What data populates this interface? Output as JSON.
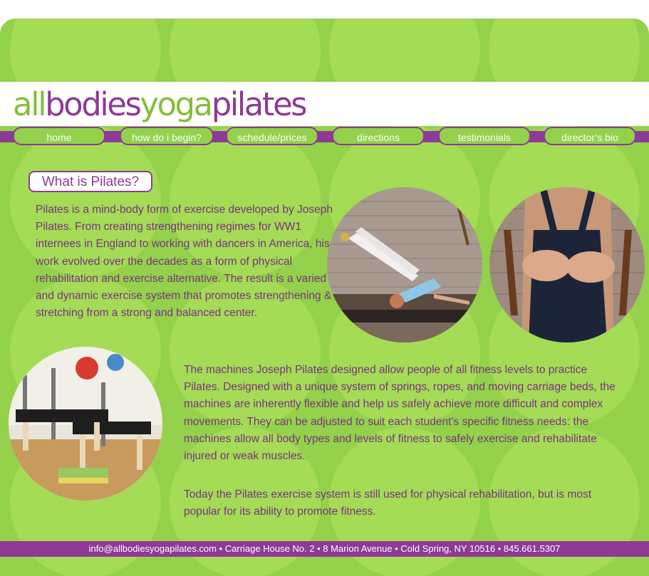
{
  "logo": {
    "part1": "all",
    "part2": "bodies",
    "part3": "yoga",
    "part4": "pilates"
  },
  "nav": {
    "items": [
      {
        "label": "home"
      },
      {
        "label": "how do i begin?"
      },
      {
        "label": "schedule/prices"
      },
      {
        "label": "directions"
      },
      {
        "label": "testimonials"
      },
      {
        "label": "director’s bio"
      }
    ]
  },
  "page": {
    "title": "What is Pilates?",
    "para1": "Pilates is a mind-body form of exercise developed by Joseph Pilates. From creating strengthening regimes for WW1 internees in England to working with dancers in America, his work evolved over the decades as a form of physical rehabilitation and exercise alternative. The result is a varied and dynamic exercise system that promotes strengthening & stretching from a strong and balanced center.",
    "para2": "The machines Joseph Pilates designed allow people of all fitness levels to practice Pilates. Designed with a unique system of springs, ropes, and moving carriage beds, the machines are inherently flexible and help us safely achieve more difficult and complex movements. They can be adjusted to suit each student’s specific fitness needs: the machines allow all body types and levels of fitness to safely exercise and rehabilitate injured or weak muscles.",
    "para3": "Today the Pilates exercise system is still used for physical rehabilitation, but is most popular for its ability to promote fitness."
  },
  "footer": {
    "text": "info@allbodiesyogapilates.com  •  Carriage House No. 2  •  8 Marion Avenue  •  Cold Spring, NY 10516  •  845.661.5307"
  },
  "colors": {
    "green": "#93d24a",
    "light_green": "#a4dc55",
    "purple": "#8e3a96"
  }
}
